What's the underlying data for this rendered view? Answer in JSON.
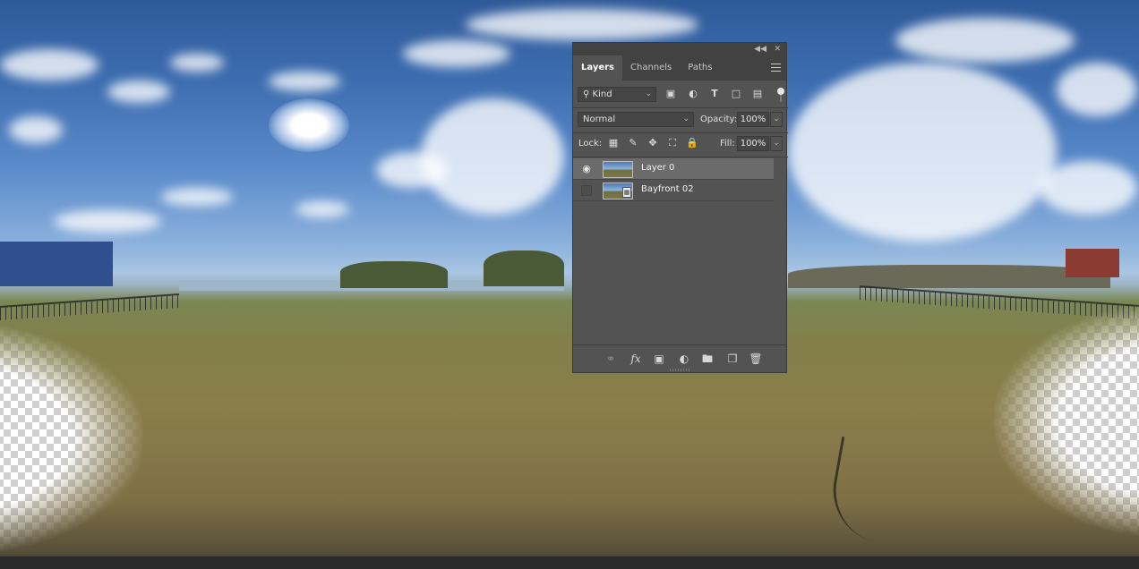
{
  "panel": {
    "tabs": [
      {
        "label": "Layers",
        "active": true
      },
      {
        "label": "Channels",
        "active": false
      },
      {
        "label": "Paths",
        "active": false
      }
    ],
    "filter": {
      "kind_label": "Kind"
    },
    "blend_mode": "Normal",
    "opacity_label": "Opacity:",
    "opacity_value": "100%",
    "lock_label": "Lock:",
    "fill_label": "Fill:",
    "fill_value": "100%",
    "layers": [
      {
        "name": "Layer 0",
        "visible": true,
        "selected": true
      },
      {
        "name": "Bayfront 02",
        "visible": false,
        "selected": false,
        "smart_object": true
      }
    ],
    "footer_icons": [
      "link-icon",
      "fx-icon",
      "mask-icon",
      "adjustment-icon",
      "group-folder-icon",
      "new-layer-icon",
      "trash-icon"
    ],
    "fx_glyph": "fx"
  },
  "colors": {
    "panel_bg": "#535353",
    "panel_header": "#424242",
    "selected_row": "#6b6b6b"
  }
}
